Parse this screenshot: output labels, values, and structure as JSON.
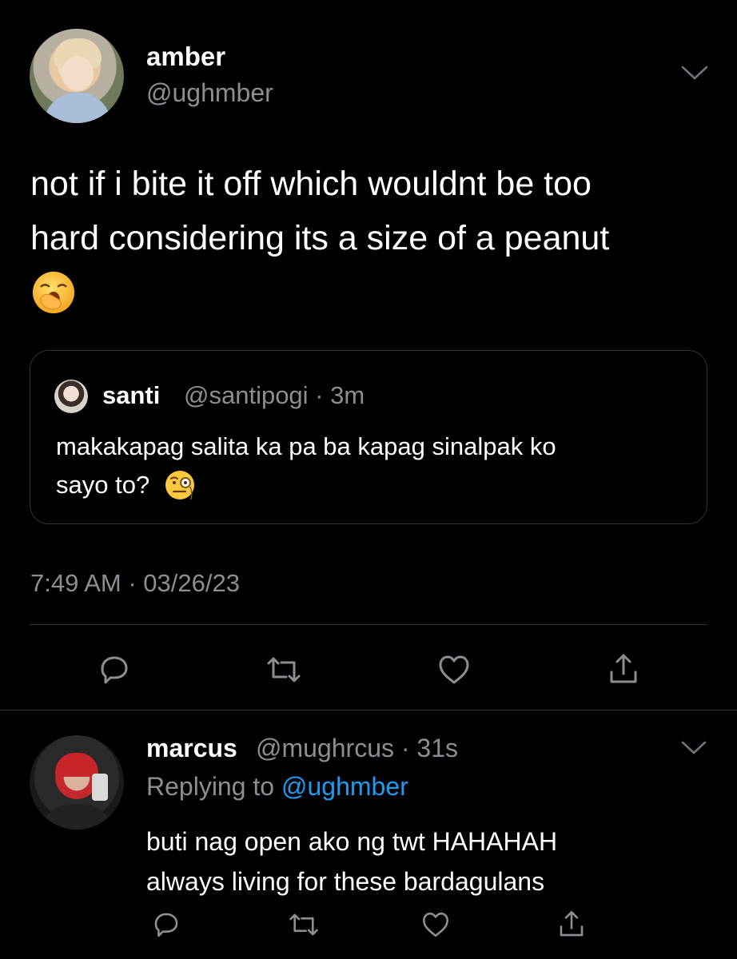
{
  "main_tweet": {
    "display_name": "amber",
    "handle": "@ughmber",
    "text_line1": "not if i bite it off which wouldnt be too",
    "text_line2": "hard considering its a size of a peanut",
    "emoji": "yawning-face-emoji",
    "timestamp": "7:49 AM · 03/26/23"
  },
  "quoted_tweet": {
    "display_name": "santi",
    "meta": "@santipogi · 3m",
    "text_line1": "makakapag salita ka pa ba kapag sinalpak ko",
    "text_line2": "sayo to?",
    "emoji": "face-with-monocle-emoji"
  },
  "reply_tweet": {
    "display_name": "marcus",
    "meta": "@mughrcus · 31s",
    "replying_label": "Replying to",
    "replying_mention": "@ughmber",
    "text_line1": "buti nag open ako ng twt HAHAHAH",
    "text_line2": "always living for these bardagulans"
  },
  "icons": {
    "more": "chevron-down-icon",
    "reply": "reply-bubble-icon",
    "retweet": "retweet-icon",
    "like": "heart-icon",
    "share": "share-icon"
  },
  "colors": {
    "background": "#000000",
    "text": "#ffffff",
    "secondary": "#8b8f94",
    "divider": "#2f3336",
    "mention": "#1d9bf0"
  }
}
